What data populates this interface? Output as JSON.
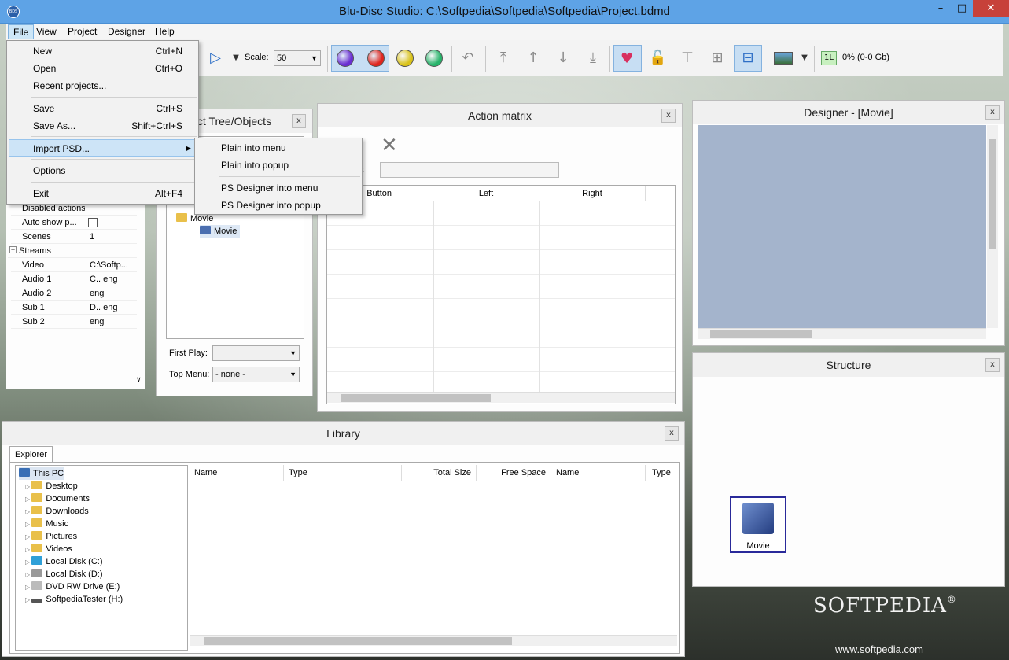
{
  "window": {
    "title": "Blu-Disc Studio: C:\\Softpedia\\Softpedia\\Softpedia\\Project.bdmd",
    "icon_text": "BDS",
    "minimize": "–",
    "maximize": "□",
    "close": "✕"
  },
  "menubar": {
    "items": [
      "File",
      "View",
      "Project",
      "Designer",
      "Help"
    ]
  },
  "toolbar": {
    "scale_label": "Scale:",
    "scale_value": "50",
    "status_badge": "1L",
    "status_text": "0% (0-0 Gb)"
  },
  "colors": {
    "circle_purple": "#6a2fd1",
    "circle_red": "#e0261e",
    "circle_yellow": "#d9c21a",
    "circle_green": "#27b36a"
  },
  "file_menu": {
    "items": [
      {
        "label": "New",
        "shortcut": "Ctrl+N"
      },
      {
        "label": "Open",
        "shortcut": "Ctrl+O"
      },
      {
        "label": "Recent projects...",
        "shortcut": ""
      },
      {
        "label": "Save",
        "shortcut": "Ctrl+S"
      },
      {
        "label": "Save As...",
        "shortcut": "Shift+Ctrl+S"
      },
      {
        "label": "Import PSD...",
        "shortcut": ""
      },
      {
        "label": "Options",
        "shortcut": ""
      },
      {
        "label": "Exit",
        "shortcut": "Alt+F4"
      }
    ],
    "submenu_arrow": "▶"
  },
  "psd_submenu": {
    "items": [
      "Plain into menu",
      "Plain into popup",
      "PS Designer into menu",
      "PS Designer into popup"
    ]
  },
  "properties": {
    "rows": [
      {
        "key": "Disabled actions",
        "value": ""
      },
      {
        "key": "Auto show p...",
        "value": ""
      },
      {
        "key": "Scenes",
        "value": "1"
      }
    ],
    "group": "Streams",
    "streams": [
      {
        "key": "Video",
        "value": "C:\\Softp..."
      },
      {
        "key": "Audio 1",
        "value": "C..  eng"
      },
      {
        "key": "Audio 2",
        "value": "       eng"
      },
      {
        "key": "Sub 1",
        "value": "D..  eng"
      },
      {
        "key": "Sub 2",
        "value": "       eng"
      }
    ]
  },
  "project_tree": {
    "title": "ct Tree/Objects",
    "nodes": [
      "Movie",
      "Movie"
    ],
    "first_play_label": "First Play:",
    "first_play_value": "",
    "top_menu_label": "Top Menu:",
    "top_menu_value": "- none -"
  },
  "action_matrix": {
    "title": "Action matrix",
    "field_label": "n:",
    "columns": [
      "Button",
      "Left",
      "Right"
    ]
  },
  "designer": {
    "title": "Designer - [Movie]"
  },
  "structure": {
    "title": "Structure",
    "node_label": "Movie"
  },
  "library": {
    "title": "Library",
    "tab": "Explorer",
    "tree": [
      "This PC",
      "Desktop",
      "Documents",
      "Downloads",
      "Music",
      "Pictures",
      "Videos",
      "Local Disk (C:)",
      "Local Disk (D:)",
      "DVD RW Drive (E:)",
      "SoftpediaTester (H:)"
    ],
    "columns": [
      "Name",
      "Type",
      "Total Size",
      "Free Space",
      "Name",
      "Type"
    ]
  },
  "watermark": {
    "brand": "SOFTPEDIA",
    "registered": "®",
    "url": "www.softpedia.com"
  }
}
